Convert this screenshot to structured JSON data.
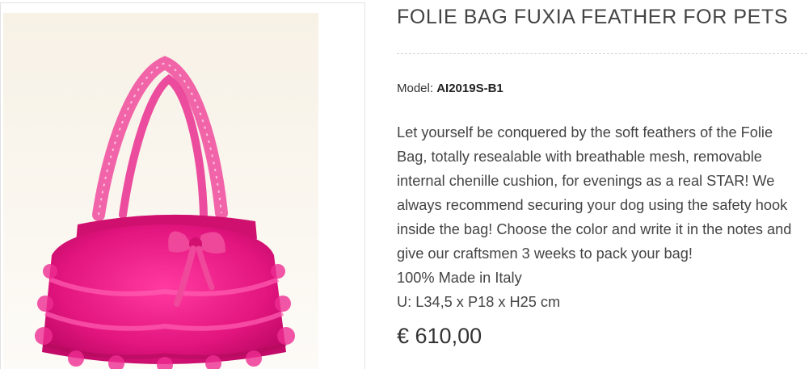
{
  "product": {
    "title": "FOLIE BAG FUXIA FEATHER FOR PETS",
    "model_label": "Model:",
    "model_value": "AI2019S-B1",
    "description": "Let yourself be conquered by the soft feathers of the Folie Bag, totally resealable with breathable mesh, removable internal chenille cushion, for evenings as a real STAR! We always recommend securing your dog using the safety hook inside the bag! Choose the color and write it in the notes and give our craftsmen 3 weeks to pack your bag!",
    "made_in": "100% Made in Italy",
    "dimensions": "U: L34,5 x P18 x H25 cm",
    "price": "€ 610,00"
  },
  "colors": {
    "feather": "#e8228a",
    "feather_dark": "#b8125f",
    "lace": "#f04a9c",
    "background": "#fbf6ee"
  },
  "image": {
    "icon": "product-photo"
  }
}
